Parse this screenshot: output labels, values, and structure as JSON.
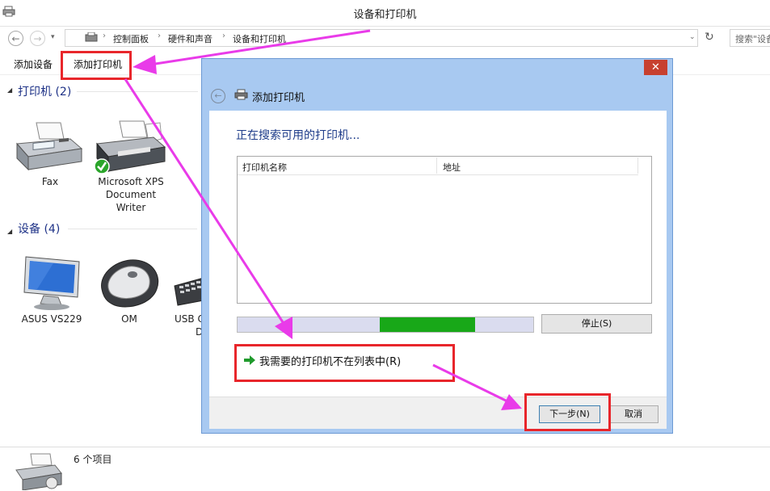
{
  "window": {
    "title": "设备和打印机"
  },
  "address_bar": {
    "breadcrumbs": [
      "控制面板",
      "硬件和声音",
      "设备和打印机"
    ],
    "search_placeholder": "搜索\"设备"
  },
  "command_bar": {
    "add_device": "添加设备",
    "add_printer": "添加打印机"
  },
  "groups": {
    "printers": {
      "header": "打印机 (2)",
      "items": [
        {
          "label": "Fax"
        },
        {
          "label": "Microsoft XPS Document Writer",
          "lines": [
            "Microsoft XPS",
            "Document",
            "Writer"
          ],
          "default": true
        }
      ]
    },
    "devices": {
      "header": "设备 (4)",
      "items": [
        {
          "label": "ASUS VS229"
        },
        {
          "label": "OM"
        },
        {
          "label": "USB C...",
          "lines": [
            "USB C",
            "D"
          ]
        }
      ]
    }
  },
  "status_bar": {
    "item_count": "6 个项目"
  },
  "dialog": {
    "title": "添加打印机",
    "close_symbol": "✕",
    "heading": "正在搜索可用的打印机...",
    "list_columns": [
      "打印机名称",
      "地址"
    ],
    "progress": 0.5,
    "stop_label": "停止(S)",
    "missing_printer_link": "我需要的打印机不在列表中(R)",
    "next_label": "下一步(N)",
    "cancel_label": "取消"
  },
  "colors": {
    "annotation_red": "#e8262b",
    "annotation_arrow": "#e93be9",
    "progress_fill": "#18a818",
    "dialog_frame": "#a8c9f1",
    "group_header": "#1e3287"
  },
  "icons": [
    "back-arrow-icon",
    "forward-arrow-icon",
    "up-arrow-icon",
    "refresh-icon",
    "fax-icon",
    "xps-printer-icon",
    "monitor-icon",
    "mouse-icon",
    "keyboard-icon",
    "green-arrow-icon"
  ]
}
